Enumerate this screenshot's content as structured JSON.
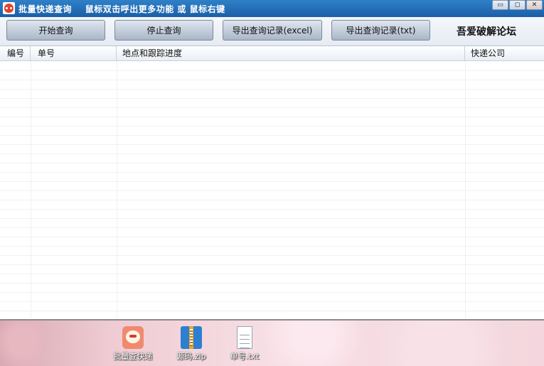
{
  "window": {
    "title": "批量快递查询    鼠标双击呼出更多功能 或 鼠标右键",
    "controls": {
      "minimize": "▭",
      "maximize": "◻",
      "close": "✕"
    }
  },
  "toolbar": {
    "start_label": "开始查询",
    "stop_label": "停止查询",
    "export_excel_label": "导出查询记录(excel)",
    "export_txt_label": "导出查询记录(txt)",
    "brand": "吾爱破解论坛"
  },
  "table": {
    "columns": [
      "编号",
      "单号",
      "地点和跟踪进度",
      "快递公司"
    ],
    "rows": []
  },
  "desktop": {
    "icons": [
      {
        "label": "批量查快递",
        "icon": "fox-app-icon"
      },
      {
        "label": "源码.zip",
        "icon": "zip-archive-icon"
      },
      {
        "label": "单号.txt",
        "icon": "text-file-icon"
      }
    ]
  },
  "colors": {
    "titlebar": "#1a5fa8",
    "button": "#aab6c8",
    "background": "#ffffff"
  }
}
